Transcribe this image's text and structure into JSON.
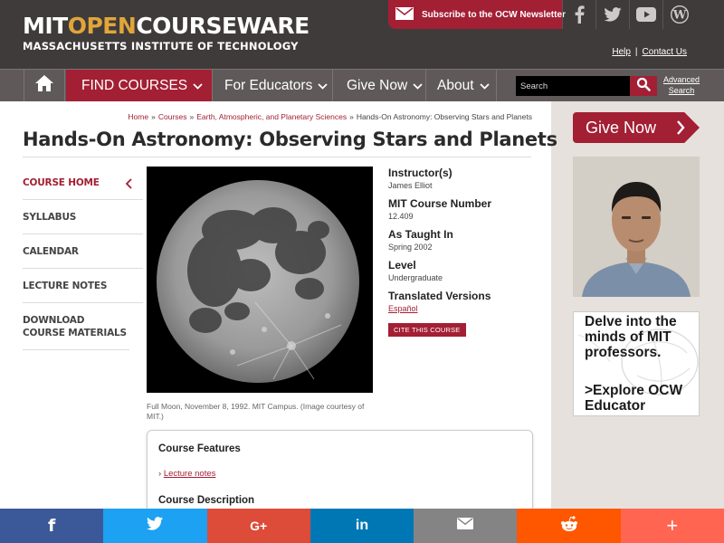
{
  "header": {
    "logo": {
      "mit": "MIT",
      "open": "OPEN",
      "courseware": "COURSEWARE",
      "subtitle": "MASSACHUSETTS INSTITUTE OF TECHNOLOGY"
    },
    "newsletter_label": "Subscribe to the OCW Newsletter",
    "social_icons": [
      "facebook-icon",
      "twitter-icon",
      "youtube-icon",
      "wordpress-icon"
    ],
    "help": "Help",
    "contact": "Contact Us",
    "separator": "|"
  },
  "nav": {
    "find_courses": "FIND COURSES",
    "for_educators": "For Educators",
    "give_now": "Give Now",
    "about": "About",
    "search_placeholder": "Search",
    "advanced_search_line1": "Advanced",
    "advanced_search_line2": "Search"
  },
  "breadcrumb": [
    "Home",
    "Courses",
    "Earth, Atmospheric, and Planetary Sciences",
    "Hands-On Astronomy: Observing Stars and Planets"
  ],
  "breadcrumb_sep": "»",
  "page_title": "Hands-On Astronomy: Observing Stars and Planets",
  "sidenav": [
    {
      "label": "COURSE HOME",
      "active": true
    },
    {
      "label": "SYLLABUS"
    },
    {
      "label": "CALENDAR"
    },
    {
      "label": "LECTURE NOTES"
    },
    {
      "label": "DOWNLOAD COURSE MATERIALS"
    }
  ],
  "image_caption": "Full Moon, November 8, 1992. MIT Campus. (Image courtesy of MIT.)",
  "course_info": {
    "instructor_label": "Instructor(s)",
    "instructor": "James Elliot",
    "number_label": "MIT Course Number",
    "number": "12.409",
    "taught_label": "As Taught In",
    "taught": "Spring 2002",
    "level_label": "Level",
    "level": "Undergraduate",
    "translated_label": "Translated Versions",
    "translated": "Español",
    "cite_button": "CITE THIS COURSE"
  },
  "features": {
    "title": "Course Features",
    "bullet": "›",
    "link": "Lecture notes",
    "description_title": "Course Description"
  },
  "sidebar": {
    "give_now": "Give Now",
    "ad_line1": "Delve into the minds of MIT professors.",
    "ad_line2": ">Explore OCW Educator"
  },
  "share_bar": [
    {
      "icon": "facebook-icon",
      "glyph": "f",
      "color": "#3b5998"
    },
    {
      "icon": "twitter-icon",
      "glyph": "",
      "color": "#1da1f2"
    },
    {
      "icon": "google-plus-icon",
      "glyph": "G+",
      "color": "#dd4b39"
    },
    {
      "icon": "linkedin-icon",
      "glyph": "in",
      "color": "#0077b5"
    },
    {
      "icon": "email-icon",
      "glyph": "",
      "color": "#848484"
    },
    {
      "icon": "reddit-icon",
      "glyph": "",
      "color": "#ff5700"
    },
    {
      "icon": "more-icon",
      "glyph": "+",
      "color": "#ff6550"
    }
  ],
  "colors": {
    "brand": "#a31f34",
    "header_bg": "#403b3b",
    "nav_bg": "#5f5959",
    "logo_accent": "#e0a63a"
  }
}
